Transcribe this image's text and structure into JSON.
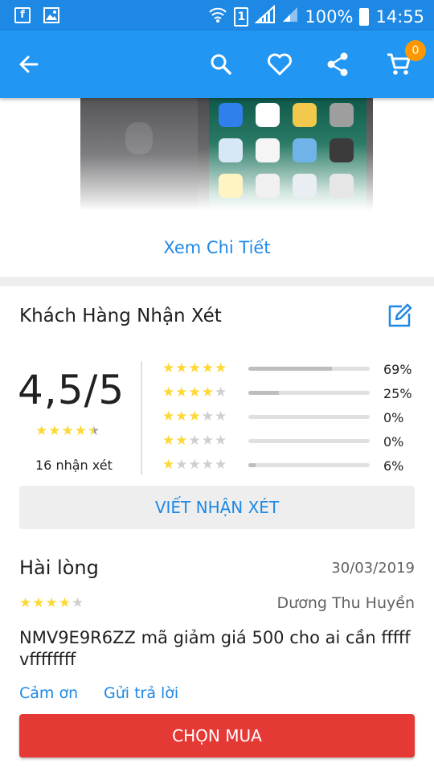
{
  "status_bar": {
    "battery": "100%",
    "time": "14:55",
    "sim_slot": "1",
    "icons": [
      "facebook-icon",
      "gallery-icon",
      "wifi-icon",
      "sim-icon",
      "signal-icon",
      "signal-icon",
      "battery-icon"
    ]
  },
  "app_bar": {
    "icons": [
      "back-arrow-icon",
      "search-icon",
      "heart-icon",
      "share-icon",
      "cart-icon"
    ],
    "cart_count": "0",
    "color": "#2196f3"
  },
  "product": {
    "image": "phone-image",
    "details_link": "Xem Chi Tiết"
  },
  "reviews": {
    "section_title": "Khách Hàng Nhận Xét",
    "average": "4,5/5",
    "average_value": 4.5,
    "count_label": "16 nhận xét",
    "distribution": [
      {
        "stars": 5,
        "percent_label": "69%",
        "value": 0.69
      },
      {
        "stars": 4,
        "percent_label": "25%",
        "value": 0.25
      },
      {
        "stars": 3,
        "percent_label": "0%",
        "value": 0.0
      },
      {
        "stars": 2,
        "percent_label": "0%",
        "value": 0.0
      },
      {
        "stars": 1,
        "percent_label": "6%",
        "value": 0.06
      }
    ],
    "write_button": "VIẾT NHẬN XÉT"
  },
  "review_item": {
    "title": "Hài lòng",
    "date": "30/03/2019",
    "rating": 4,
    "author": "Dương Thu Huyền",
    "body": "NMV9E9R6ZZ mã giảm giá 500 cho ai cần fffffvffffffff",
    "thanks_link": "Cảm ơn",
    "reply_link": "Gửi trả lời"
  },
  "buy_button": "CHỌN MUA",
  "colors": {
    "accent": "#1e88e5",
    "buy": "#e53935",
    "star": "#fdd835",
    "badge": "#ff9800"
  }
}
